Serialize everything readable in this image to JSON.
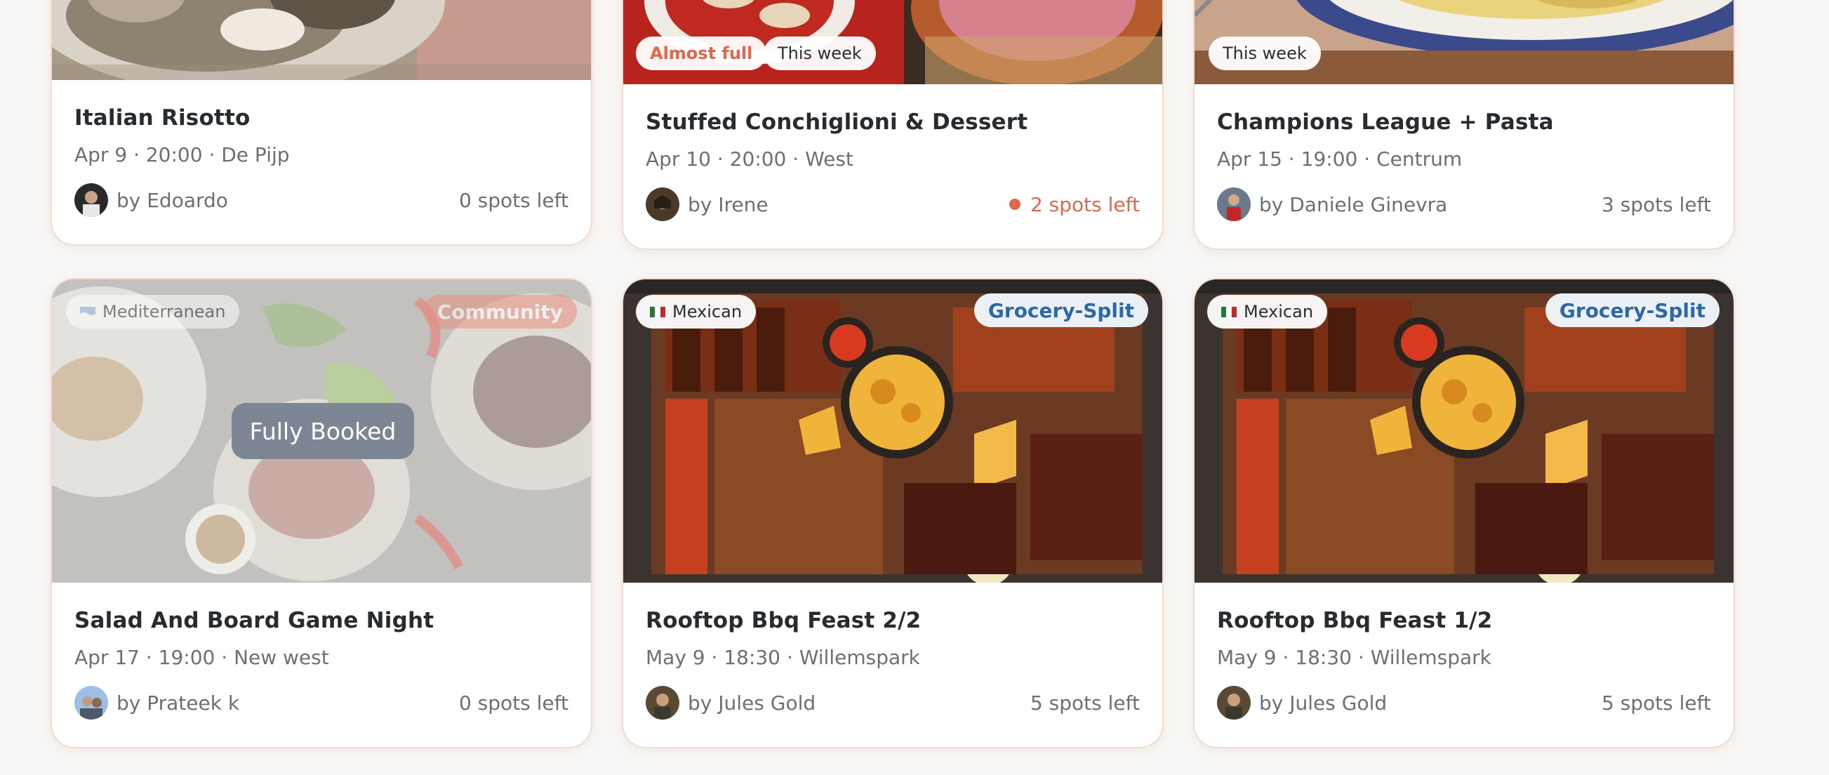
{
  "cards": [
    {
      "title": "Italian Risotto",
      "meta": "Apr 9 · 20:00 · De Pijp",
      "host": "by Edoardo",
      "spots": "0 spots left",
      "badges": []
    },
    {
      "title": "Stuffed Conchiglioni & Dessert",
      "meta": "Apr 10 · 20:00 · West",
      "host": "by Irene",
      "spots": "2 spots left",
      "spots_urgent": true,
      "badges": [
        "Almost full",
        "This week"
      ]
    },
    {
      "title": "Champions League + Pasta",
      "meta": "Apr 15 · 19:00 · Centrum",
      "host": "by Daniele Ginevra",
      "spots": "3 spots left",
      "badges": [
        "This week"
      ]
    },
    {
      "title": "Salad And Board Game Night",
      "meta": "Apr 17 · 19:00 · New west",
      "host": "by Prateek k",
      "spots": "0 spots left",
      "cuisine": "Mediterranean",
      "cuisine_icon": "wave-flag-icon",
      "tag": "Community",
      "status": "Fully Booked"
    },
    {
      "title": "Rooftop Bbq Feast 2/2",
      "meta": "May 9 · 18:30 · Willemspark",
      "host": "by Jules Gold",
      "spots": "5 spots left",
      "cuisine": "Mexican",
      "cuisine_icon": "mexico-flag-icon",
      "tag": "Grocery-Split"
    },
    {
      "title": "Rooftop Bbq Feast 1/2",
      "meta": "May 9 · 18:30 · Willemspark",
      "host": "by Jules Gold",
      "spots": "5 spots left",
      "cuisine": "Mexican",
      "cuisine_icon": "mexico-flag-icon",
      "tag": "Grocery-Split"
    }
  ],
  "colors": {
    "accent_coral": "#e0664d",
    "tag_blue": "#2b69a8",
    "booked_gray": "#7c8694",
    "card_border": "#f3dccd"
  }
}
